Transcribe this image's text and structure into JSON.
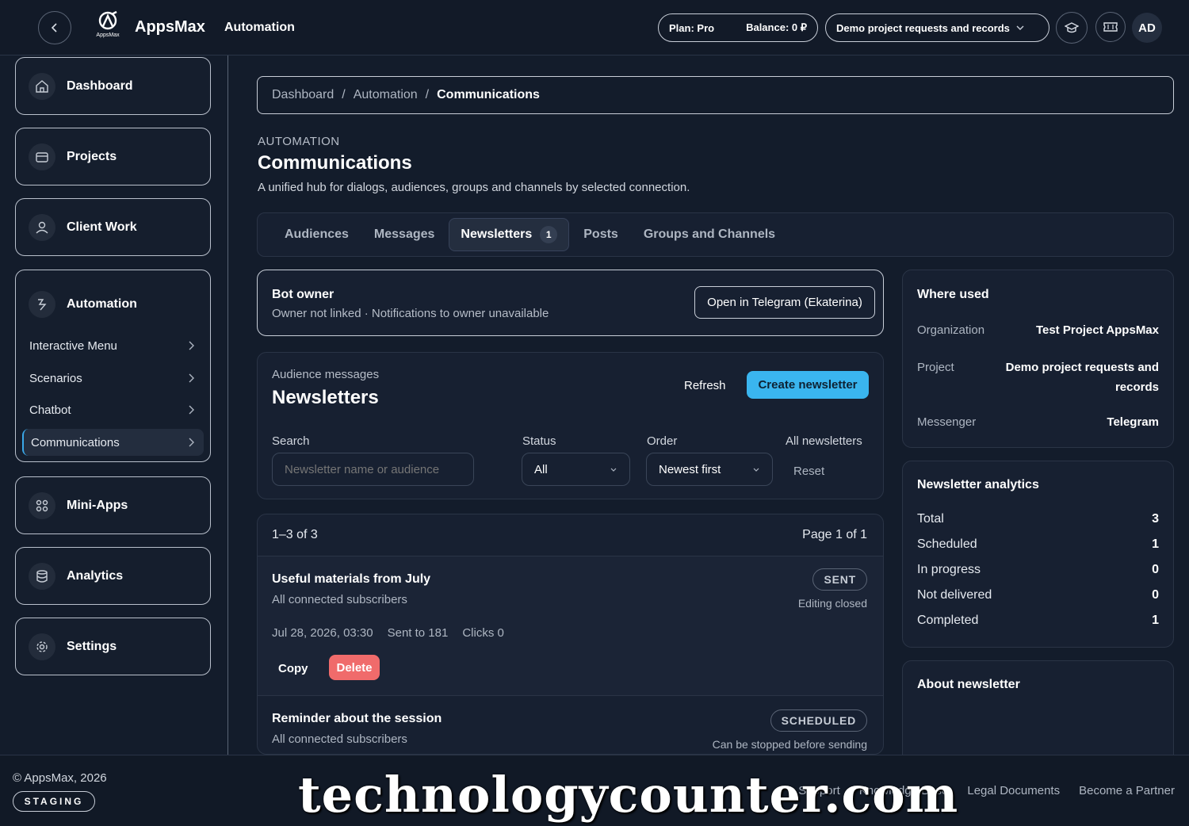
{
  "header": {
    "brand": "AppsMax",
    "logo_caption": "AppsMax",
    "section": "Automation",
    "plan": "Plan: Pro",
    "balance": "Balance: 0 ₽",
    "project": "Demo project requests and records",
    "avatar": "AD"
  },
  "sidebar": {
    "items": [
      {
        "label": "Dashboard",
        "icon": "home-icon"
      },
      {
        "label": "Projects",
        "icon": "folder-icon"
      },
      {
        "label": "Client Work",
        "icon": "user-icon"
      },
      {
        "label": "Automation",
        "icon": "automation-icon"
      },
      {
        "label": "Mini-Apps",
        "icon": "apps-icon"
      },
      {
        "label": "Analytics",
        "icon": "database-icon"
      },
      {
        "label": "Settings",
        "icon": "gear-icon"
      }
    ],
    "automation_sub": [
      {
        "label": "Interactive Menu"
      },
      {
        "label": "Scenarios"
      },
      {
        "label": "Chatbot"
      },
      {
        "label": "Communications"
      }
    ]
  },
  "breadcrumb": [
    "Dashboard",
    "Automation",
    "Communications"
  ],
  "page": {
    "eyebrow": "AUTOMATION",
    "title": "Communications",
    "description": "A unified hub for dialogs, audiences, groups and channels by selected connection."
  },
  "tabs": [
    {
      "label": "Audiences"
    },
    {
      "label": "Messages"
    },
    {
      "label": "Newsletters",
      "badge": "1"
    },
    {
      "label": "Posts"
    },
    {
      "label": "Groups and Channels"
    }
  ],
  "bot": {
    "title": "Bot owner",
    "status": "Owner not linked · Notifications to owner unavailable",
    "open_button": "Open in Telegram (Ekaterina)"
  },
  "newsletters": {
    "eyebrow": "Audience messages",
    "title": "Newsletters",
    "refresh": "Refresh",
    "create": "Create newsletter",
    "search_label": "Search",
    "search_placeholder": "Newsletter name or audience",
    "status_label": "Status",
    "status_value": "All",
    "order_label": "Order",
    "order_value": "Newest first",
    "all_label": "All newsletters",
    "reset": "Reset"
  },
  "list": {
    "range": "1–3 of 3",
    "page": "Page 1 of 1",
    "items": [
      {
        "title": "Useful materials from July",
        "audience": "All connected subscribers",
        "status": "SENT",
        "status_note": "Editing closed",
        "date": "Jul 28, 2026, 03:30",
        "sent": "Sent to 181",
        "clicks": "Clicks 0",
        "copy": "Copy",
        "delete": "Delete"
      },
      {
        "title": "Reminder about the session",
        "audience": "All connected subscribers",
        "status": "SCHEDULED",
        "status_note": "Can be stopped before sending"
      }
    ]
  },
  "where_used": {
    "title": "Where used",
    "rows": [
      {
        "key": "Organization",
        "value": "Test Project AppsMax"
      },
      {
        "key": "Project",
        "value": "Demo project requests and records"
      },
      {
        "key": "Messenger",
        "value": "Telegram"
      }
    ]
  },
  "analytics": {
    "title": "Newsletter analytics",
    "rows": [
      {
        "key": "Total",
        "value": "3"
      },
      {
        "key": "Scheduled",
        "value": "1"
      },
      {
        "key": "In progress",
        "value": "0"
      },
      {
        "key": "Not delivered",
        "value": "0"
      },
      {
        "key": "Completed",
        "value": "1"
      }
    ]
  },
  "about": {
    "title": "About newsletter"
  },
  "footer": {
    "copyright": "© AppsMax, 2026",
    "env": "STAGING",
    "links": [
      "Support",
      "Knowledge Base",
      "Legal Documents",
      "Become a Partner"
    ]
  },
  "watermark": "technologycounter.com"
}
